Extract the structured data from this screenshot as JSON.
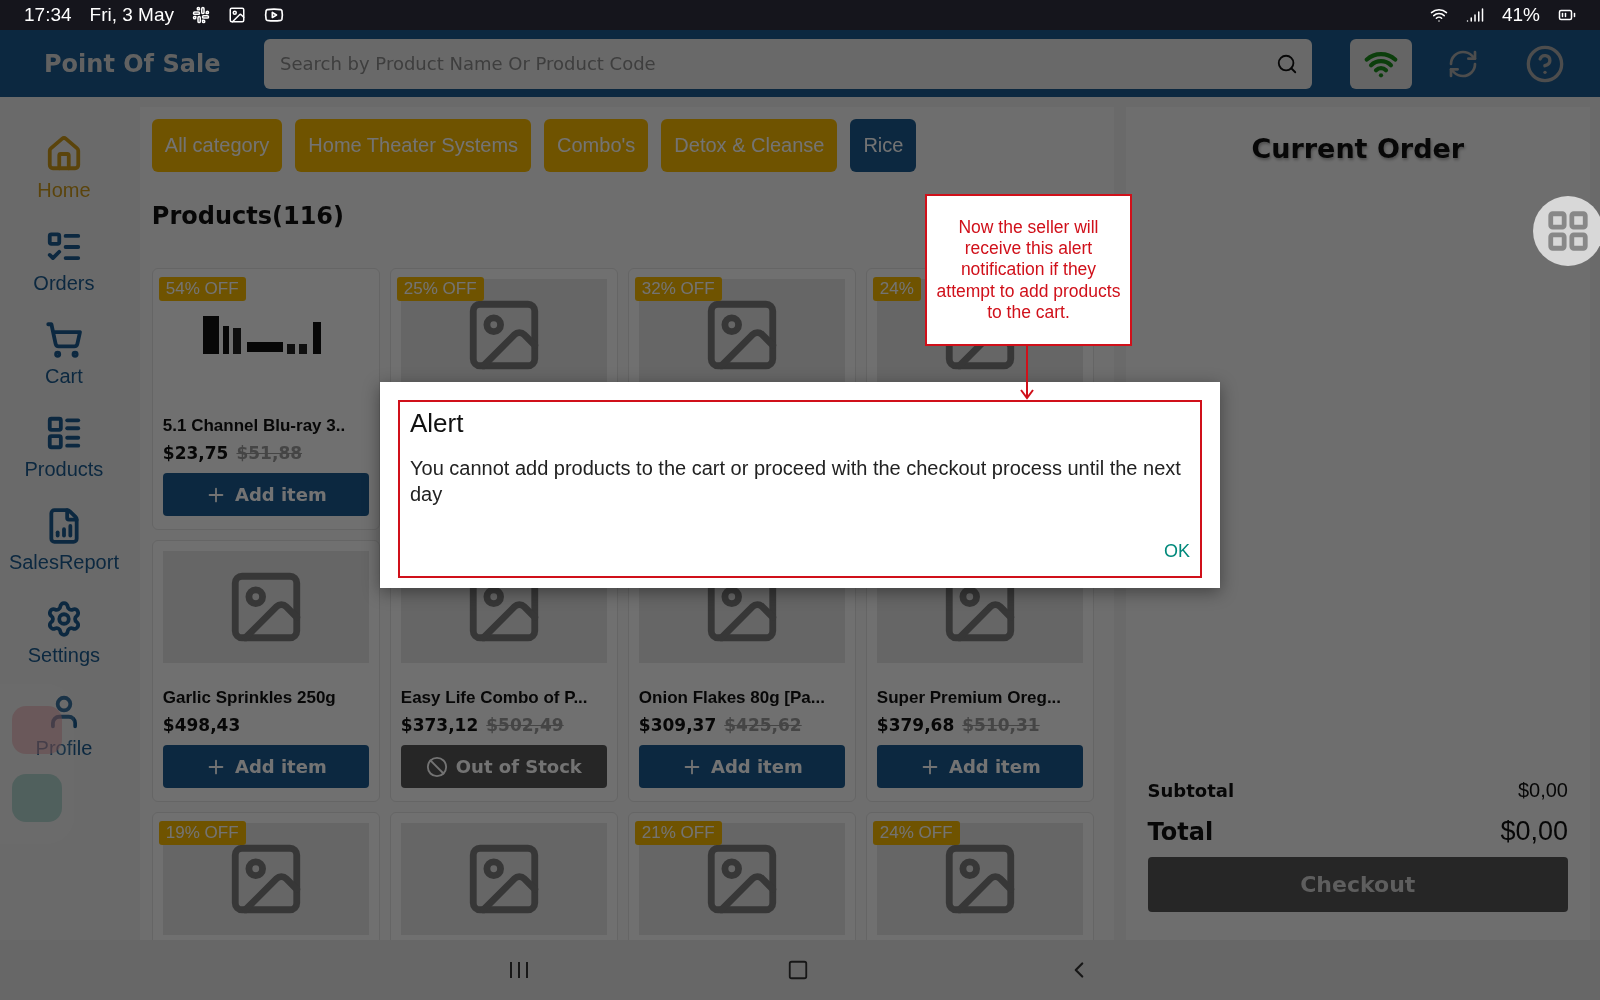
{
  "status_bar": {
    "time": "17:34",
    "date": "Fri, 3 May",
    "battery": "41%"
  },
  "app_bar": {
    "title": "Point Of Sale",
    "search": {
      "placeholder": "Search by Product Name Or Product Code"
    },
    "online": true
  },
  "sidebar": {
    "items": [
      {
        "label": "Home",
        "selected": true
      },
      {
        "label": "Orders",
        "selected": false
      },
      {
        "label": "Cart",
        "selected": false
      },
      {
        "label": "Products",
        "selected": false
      },
      {
        "label": "SalesReport",
        "selected": false
      },
      {
        "label": "Settings",
        "selected": false
      },
      {
        "label": "Profile",
        "selected": false
      }
    ]
  },
  "categories": [
    {
      "label": "All category",
      "selected": false
    },
    {
      "label": "Home Theater Systems",
      "selected": false
    },
    {
      "label": "Combo's",
      "selected": false
    },
    {
      "label": "Detox & Cleanse",
      "selected": false
    },
    {
      "label": "Rice",
      "selected": true
    }
  ],
  "products_heading": "Products(116)",
  "products": [
    {
      "badge": "54% OFF",
      "kind": "photo",
      "name": "5.1 Channel Blu-ray 3..",
      "price": "$23,75",
      "old_price": "$51,88",
      "button": {
        "kind": "add",
        "label": "Add item"
      }
    },
    {
      "badge": "25% OFF",
      "kind": "placeholder"
    },
    {
      "badge": "32% OFF",
      "kind": "placeholder"
    },
    {
      "badge": "24%",
      "kind": "placeholder"
    },
    {
      "kind": "placeholder",
      "name": "Garlic Sprinkles 250g",
      "price": "$498,43",
      "button": {
        "kind": "add",
        "label": "Add item"
      }
    },
    {
      "kind": "placeholder",
      "name": "Easy Life Combo of P...",
      "price": "$373,12",
      "old_price": "$502,49",
      "button": {
        "kind": "out_of_stock",
        "label": "Out of Stock"
      }
    },
    {
      "kind": "placeholder",
      "name": "Onion Flakes 80g [Pa...",
      "price": "$309,37",
      "old_price": "$425,62",
      "button": {
        "kind": "add",
        "label": "Add item"
      }
    },
    {
      "kind": "placeholder",
      "name": "Super Premium Oreg...",
      "price": "$379,68",
      "old_price": "$510,31",
      "button": {
        "kind": "add",
        "label": "Add item"
      }
    },
    {
      "badge": "19% OFF",
      "kind": "placeholder"
    },
    {
      "kind": "placeholder"
    },
    {
      "badge": "21% OFF",
      "kind": "placeholder"
    },
    {
      "badge": "24% OFF",
      "kind": "placeholder"
    }
  ],
  "order": {
    "title": "Current Order",
    "subtotal_label": "Subtotal",
    "subtotal": "$0,00",
    "total_label": "Total",
    "total": "$0,00",
    "checkout": {
      "label": "Checkout",
      "disabled": true
    }
  },
  "dialog": {
    "title": "Alert",
    "message": "You cannot add products to the cart or proceed with the checkout process until the next day",
    "button": "OK"
  },
  "annotation": {
    "text": "Now the seller will receive this alert notification if they attempt to add products to the cart."
  }
}
